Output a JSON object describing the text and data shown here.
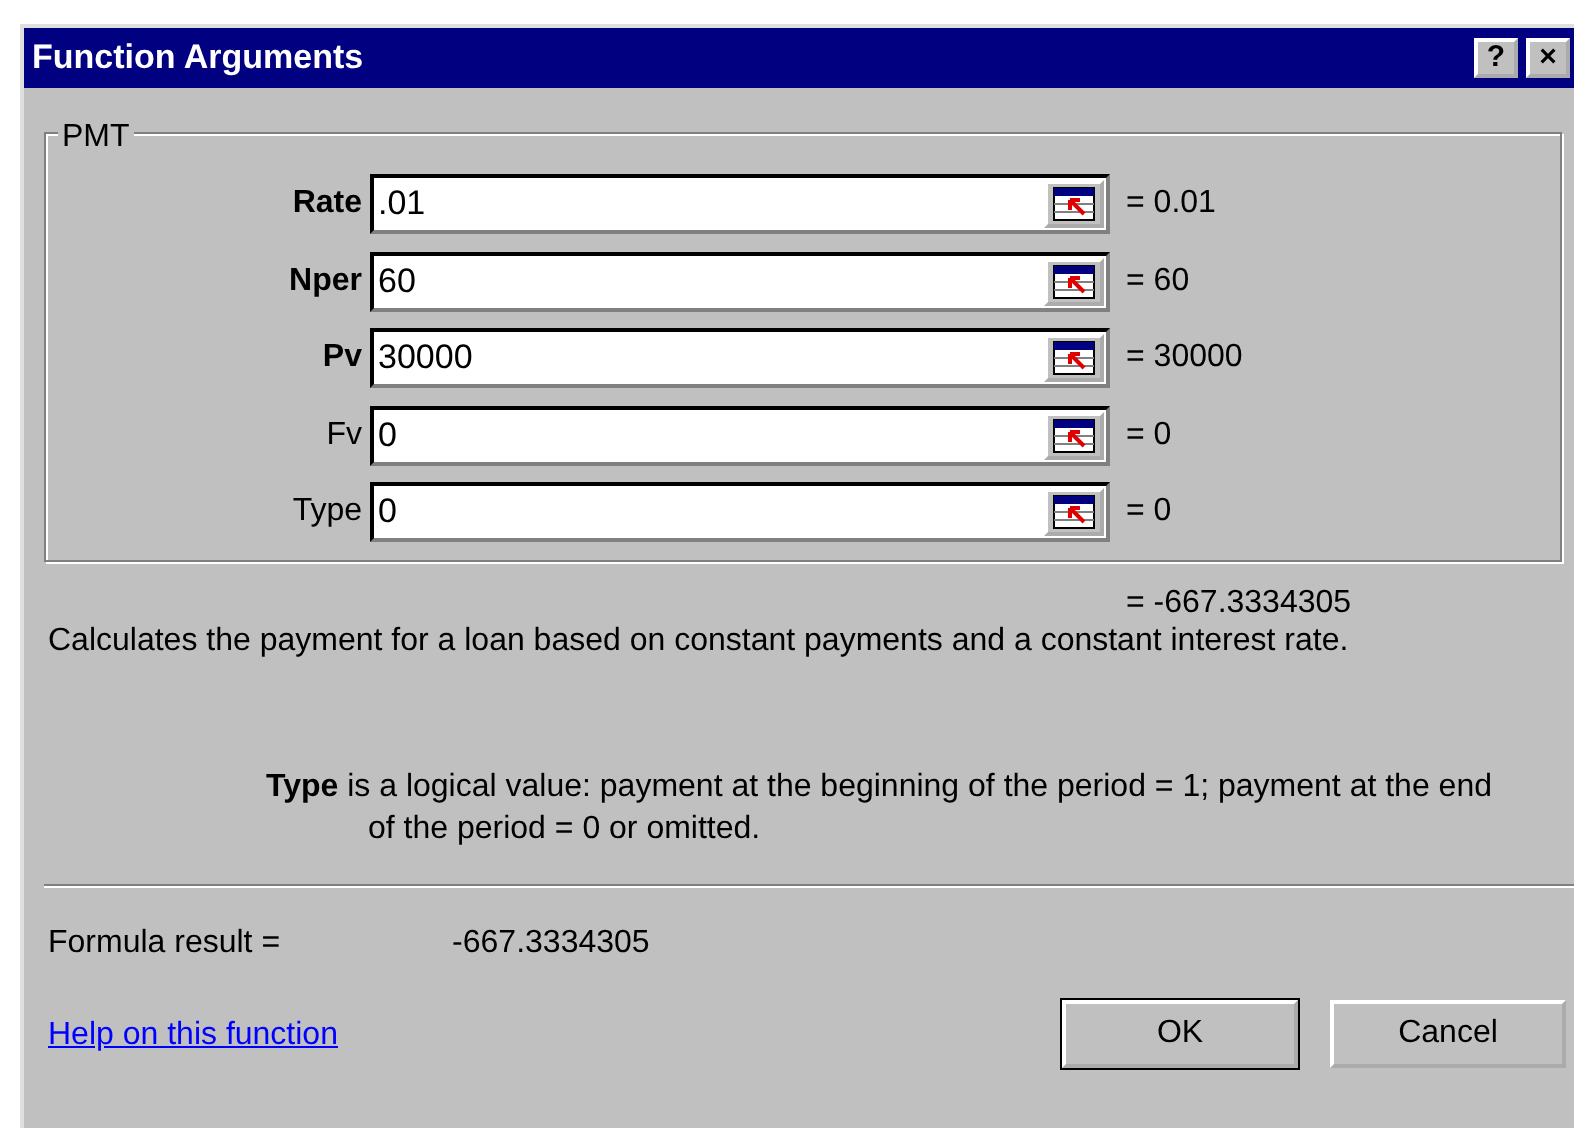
{
  "window": {
    "title": "Function Arguments",
    "title_buttons": [
      "?",
      "×"
    ]
  },
  "group": {
    "label": "PMT",
    "arguments": [
      {
        "label": "Rate",
        "required": true,
        "value": ".01",
        "result": "= 0.01"
      },
      {
        "label": "Nper",
        "required": true,
        "value": "60",
        "result": "= 60"
      },
      {
        "label": "Pv",
        "required": true,
        "value": "30000",
        "result": "= 30000"
      },
      {
        "label": "Fv",
        "required": false,
        "value": "0",
        "result": "= 0"
      },
      {
        "label": "Type",
        "required": false,
        "value": "0",
        "result": "= 0"
      }
    ]
  },
  "function_result": "= -667.3334305",
  "description": "Calculates the payment for a loan based on constant payments and a constant interest rate.",
  "argument_help": "**Type** is a logical value: payment at the beginning of the period = 1; payment at the end of the period = 0 or omitted.",
  "formula_result": {
    "label": "Formula result =",
    "value": "-667.3334305"
  },
  "help_link": "Help on this function",
  "buttons": [
    {
      "label": "OK",
      "default": true
    },
    {
      "label": "Cancel",
      "default": false
    }
  ]
}
